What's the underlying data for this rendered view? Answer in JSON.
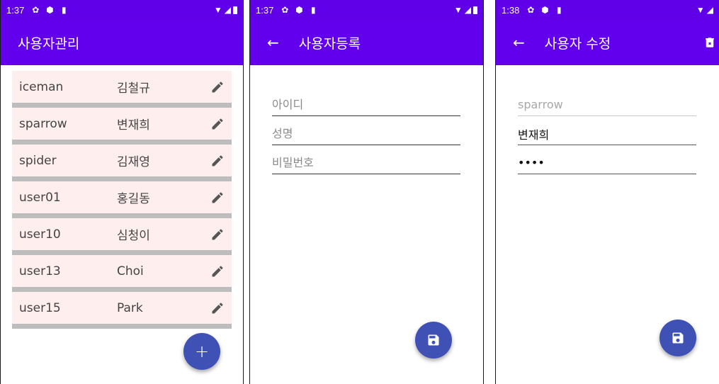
{
  "screens": {
    "list": {
      "status_time": "1:37",
      "title": "사용자관리",
      "users": [
        {
          "id": "iceman",
          "name": "김철규"
        },
        {
          "id": "sparrow",
          "name": "변재희"
        },
        {
          "id": "spider",
          "name": "김재영"
        },
        {
          "id": "user01",
          "name": "홍길동"
        },
        {
          "id": "user10",
          "name": "심청이"
        },
        {
          "id": "user13",
          "name": "Choi"
        },
        {
          "id": "user15",
          "name": "Park"
        }
      ],
      "fab_label": "+"
    },
    "register": {
      "status_time": "1:37",
      "title": "사용자등록",
      "back_icon": "←",
      "fields": [
        {
          "placeholder": "아이디",
          "value": ""
        },
        {
          "placeholder": "성명",
          "value": ""
        },
        {
          "placeholder": "비밀번호",
          "value": ""
        }
      ]
    },
    "edit": {
      "status_time": "1:38",
      "title": "사용자 수정",
      "back_icon": "←",
      "fields": [
        {
          "placeholder": "",
          "value": "sparrow"
        },
        {
          "placeholder": "",
          "value": "변재희"
        },
        {
          "placeholder": "",
          "value": "••••"
        }
      ]
    }
  },
  "icons": {
    "status": [
      "gear-icon",
      "shield-icon",
      "sd-card-icon"
    ],
    "status_right": [
      "wifi-icon",
      "signal-icon",
      "battery-icon"
    ],
    "edit": "pencil-icon",
    "save": "floppy-disk-icon",
    "delete": "delete-icon"
  },
  "colors": {
    "status_bar": "#5f00e8",
    "app_bar": "#6200ee",
    "fab": "#3f51b5",
    "row_bg": "#ffeeee",
    "row_divider": "#bdbdbd"
  }
}
